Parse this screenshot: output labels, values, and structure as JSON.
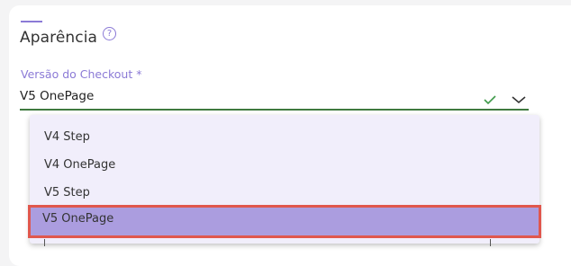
{
  "section": {
    "title": "Aparência",
    "help_icon": "question-circle-icon",
    "help_glyph": "?"
  },
  "field": {
    "label": "Versão do Checkout *",
    "value": "V5 OnePage",
    "valid_icon": "check-icon",
    "toggle_icon": "chevron-down-icon"
  },
  "dropdown": {
    "options": [
      {
        "label": "V4 Step",
        "selected": false
      },
      {
        "label": "V4 OnePage",
        "selected": false
      },
      {
        "label": "V5 Step",
        "selected": false
      },
      {
        "label": "V5 OnePage",
        "selected": true
      }
    ]
  },
  "colors": {
    "accent": "#8b7ad6",
    "valid_underline": "#3f7a3f",
    "selected_option_bg": "#ab9ddf",
    "highlight_border": "#e0574d"
  }
}
